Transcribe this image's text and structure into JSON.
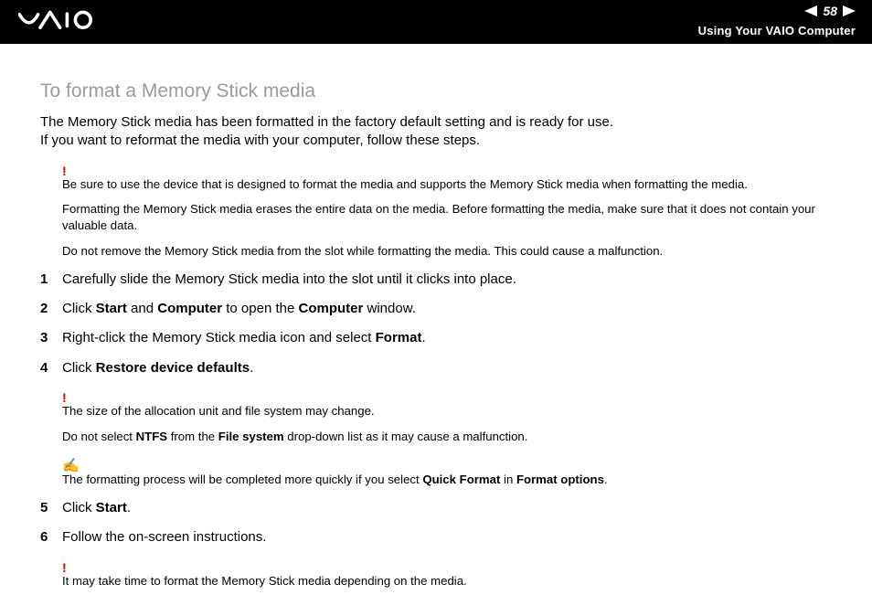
{
  "header": {
    "page_number": "58",
    "section": "Using Your VAIO Computer"
  },
  "heading": "To format a Memory Stick media",
  "intro_line1": "The Memory Stick media has been formatted in the factory default setting and is ready for use.",
  "intro_line2": "If you want to reformat the media with your computer, follow these steps.",
  "warn1": {
    "p1": "Be sure to use the device that is designed to format the media and supports the Memory Stick media when formatting the media.",
    "p2": "Formatting the Memory Stick media erases the entire data on the media. Before formatting the media, make sure that it does not contain your valuable data.",
    "p3": "Do not remove the Memory Stick media from the slot while formatting the media. This could cause a malfunction."
  },
  "steps": {
    "s1": {
      "n": "1",
      "t": "Carefully slide the Memory Stick media into the slot until it clicks into place."
    },
    "s2": {
      "n": "2",
      "pre": "Click ",
      "b1": "Start",
      "mid": " and ",
      "b2": "Computer",
      "post1": " to open the ",
      "b3": "Computer",
      "post2": " window."
    },
    "s3": {
      "n": "3",
      "pre": "Right-click the Memory Stick media icon and select ",
      "b1": "Format",
      "post": "."
    },
    "s4": {
      "n": "4",
      "pre": "Click ",
      "b1": "Restore device defaults",
      "post": "."
    },
    "s5": {
      "n": "5",
      "pre": "Click ",
      "b1": "Start",
      "post": "."
    },
    "s6": {
      "n": "6",
      "t": "Follow the on-screen instructions."
    }
  },
  "warn2": {
    "p1": "The size of the allocation unit and file system may change.",
    "p2_pre": "Do not select ",
    "p2_b1": "NTFS",
    "p2_mid": " from the ",
    "p2_b2": "File system",
    "p2_post": " drop-down list as it may cause a malfunction."
  },
  "note1": {
    "pre": "The formatting process will be completed more quickly if you select ",
    "b1": "Quick Format",
    "mid": " in ",
    "b2": "Format options",
    "post": "."
  },
  "warn3": {
    "p1": "It may take time to format the Memory Stick media depending on the media."
  }
}
